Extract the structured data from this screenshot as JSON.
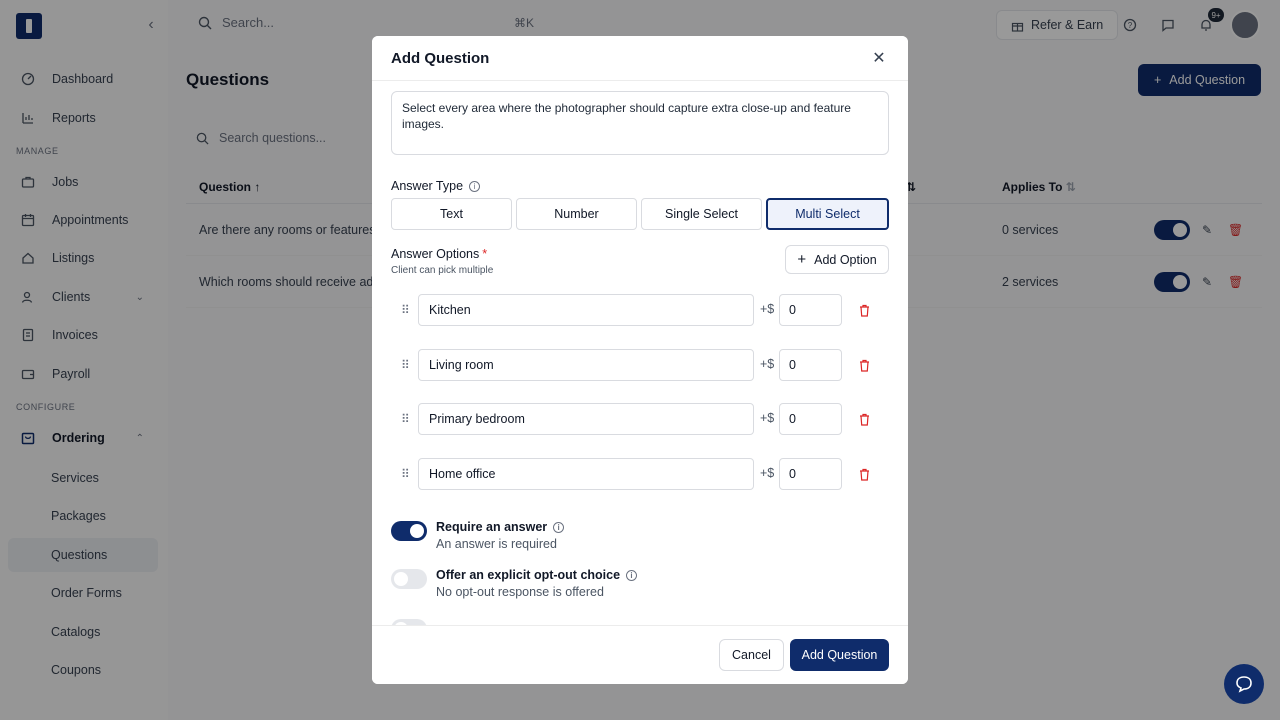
{
  "sidebar": {
    "collapse_icon": "chevron-left-icon",
    "items_top": [
      {
        "label": "Dashboard",
        "icon": "dashboard-icon"
      },
      {
        "label": "Reports",
        "icon": "chart-icon"
      }
    ],
    "section_manage": "MANAGE",
    "items_manage": [
      {
        "label": "Jobs",
        "icon": "briefcase-icon"
      },
      {
        "label": "Appointments",
        "icon": "calendar-icon"
      },
      {
        "label": "Listings",
        "icon": "home-icon"
      },
      {
        "label": "Clients",
        "icon": "users-icon"
      },
      {
        "label": "Invoices",
        "icon": "invoice-icon"
      },
      {
        "label": "Payroll",
        "icon": "wallet-icon"
      }
    ],
    "section_configure": "CONFIGURE",
    "ordering": {
      "label": "Ordering",
      "icon": "ordering-icon"
    },
    "ordering_sub": [
      {
        "label": "Services"
      },
      {
        "label": "Packages"
      },
      {
        "label": "Questions"
      },
      {
        "label": "Order Forms"
      },
      {
        "label": "Catalogs"
      },
      {
        "label": "Coupons"
      }
    ]
  },
  "topbar": {
    "search_placeholder": "Search...",
    "search_shortcut": "⌘K",
    "refer_label": "Refer & Earn",
    "notification_badge": "9+"
  },
  "page": {
    "title": "Questions",
    "add_button": "Add Question",
    "list_search_placeholder": "Search questions...",
    "columns": {
      "question": "Question",
      "applies_to": "Applies To"
    },
    "rows": [
      {
        "question": "Are there any rooms or features",
        "applies_to": "0 services",
        "active": true
      },
      {
        "question": "Which rooms should receive add",
        "applies_to": "2 services",
        "active": true
      }
    ]
  },
  "modal": {
    "title": "Add Question",
    "description_value": "Select every area where the photographer should capture extra close-up and feature images.",
    "answer_type_label": "Answer Type",
    "answer_types": [
      "Text",
      "Number",
      "Single Select",
      "Multi Select"
    ],
    "answer_type_selected": "Multi Select",
    "answer_options_label": "Answer Options",
    "required_marker": "*",
    "answer_options_help": "Client can pick multiple",
    "add_option_label": "Add Option",
    "price_prefix": "+$",
    "options": [
      {
        "label": "Kitchen",
        "price": "0"
      },
      {
        "label": "Living room",
        "price": "0"
      },
      {
        "label": "Primary bedroom",
        "price": "0"
      },
      {
        "label": "Home office",
        "price": "0"
      }
    ],
    "require_answer": {
      "title": "Require an answer",
      "subtitle": "An answer is required",
      "on": true
    },
    "opt_out": {
      "title": "Offer an explicit opt-out choice",
      "subtitle": "No opt-out response is offered",
      "on": false
    },
    "cancel_label": "Cancel",
    "submit_label": "Add Question"
  },
  "colors": {
    "brand": "#0f2c6b",
    "danger": "#dc2626"
  }
}
